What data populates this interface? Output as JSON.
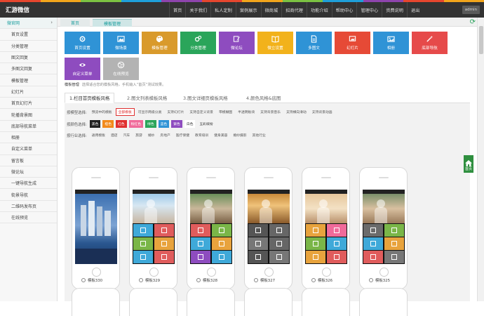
{
  "brand": "汇游微信",
  "stripe_colors": [
    "#e6462e",
    "#f2a51b",
    "#7bc242",
    "#1e9fd9",
    "#8e44ad",
    "#e6462e",
    "#f2a51b",
    "#7bc242",
    "#1e9fd9",
    "#8e44ad",
    "#e6462e",
    "#f2a51b"
  ],
  "topnav": [
    "首页",
    "关于我们",
    "私人定制",
    "案例展示",
    "微商城",
    "招商代理",
    "功能介绍",
    "帮助中心",
    "管理中心",
    "资费说明",
    "退出"
  ],
  "admin": "admin",
  "sidebar": {
    "title": "微官网",
    "items": [
      "首页设置",
      "分类管理",
      "图文回复",
      "多图文回复",
      "模板管理",
      "幻灯片",
      "首页幻灯片",
      "轮播背景图",
      "底部导航菜单",
      "相册",
      "自定义菜单",
      "留言板",
      "微论坛",
      "一键导航生成",
      "街景导航",
      "二维码发布页",
      "在线预览"
    ]
  },
  "tabs": {
    "home": "首页",
    "current": "模板管理"
  },
  "tiles": [
    {
      "label": "首页设置",
      "color": "#2f93d6",
      "icon": "gear-icon"
    },
    {
      "label": "微场景",
      "color": "#2f93d6",
      "icon": "picture-icon"
    },
    {
      "label": "模板管理",
      "color": "#d99a2b",
      "icon": "palette-icon"
    },
    {
      "label": "分类管理",
      "color": "#2aa55a",
      "icon": "gears-icon"
    },
    {
      "label": "微论坛",
      "color": "#8e4cbf",
      "icon": "edit-icon"
    },
    {
      "label": "微立设置",
      "color": "#f2b21b",
      "icon": "book-icon"
    },
    {
      "label": "多图文",
      "color": "#2f93d6",
      "icon": "file-icon"
    },
    {
      "label": "幻灯片",
      "color": "#e64a36",
      "icon": "slides-icon"
    },
    {
      "label": "相册",
      "color": "#2f93d6",
      "icon": "album-icon"
    },
    {
      "label": "底部导航",
      "color": "#e64a4a",
      "icon": "magic-icon"
    },
    {
      "label": "自定义菜单",
      "color": "#8e4cbf",
      "icon": "eye-icon"
    },
    {
      "label": "在线预览",
      "color": "#b3b3b3",
      "icon": "globe-icon"
    }
  ],
  "intro": {
    "title": "模板管理",
    "desc": "选择适合您的模板风格，手机输入“首页”测试效果。"
  },
  "content_tabs": [
    "1.栏目首页模板风格",
    "2.图文列表模板风格",
    "3.图文详细页模板风格",
    "4.颜色风格&底图"
  ],
  "filters": {
    "type_label": "按模型选择:",
    "type_options": [
      "预览中的模板",
      "全部模板",
      "可显示两级分类",
      "支持幻灯片",
      "支持自定义背景",
      "带模糊图",
      "半透明板块",
      "支持背景音乐",
      "支持横向滑动",
      "支持背景动画"
    ],
    "type_selected": 1,
    "color_label": "按颜色选择:",
    "colors": [
      {
        "name": "黑色",
        "bg": "#222222"
      },
      {
        "name": "橙色",
        "bg": "#f28a1b"
      },
      {
        "name": "红色",
        "bg": "#e03030"
      },
      {
        "name": "粉红色",
        "bg": "#f06a9a"
      },
      {
        "name": "绿色",
        "bg": "#2aa55a"
      },
      {
        "name": "蓝色",
        "bg": "#2f93d6"
      },
      {
        "name": "紫色",
        "bg": "#8e4cbf"
      },
      {
        "name": "白色",
        "bg": "#ffffff"
      },
      {
        "name": "五彩缤纷",
        "bg": ""
      }
    ],
    "industry_label": "按行业选择:",
    "industry_options": [
      "通用模板",
      "酒店",
      "汽车",
      "旅游",
      "婚纱",
      "房地产",
      "医疗保健",
      "教育培训",
      "健身美容",
      "婚纱摄影",
      "其他行业"
    ]
  },
  "templates": [
    {
      "name": "模板330",
      "theme": "city"
    },
    {
      "name": "模板329",
      "theme": "wedding"
    },
    {
      "name": "模板328",
      "theme": "couple"
    },
    {
      "name": "模板327",
      "theme": "sunset"
    },
    {
      "name": "模板326",
      "theme": "bride"
    },
    {
      "name": "模板325",
      "theme": "girl"
    }
  ],
  "float_home": "首页"
}
